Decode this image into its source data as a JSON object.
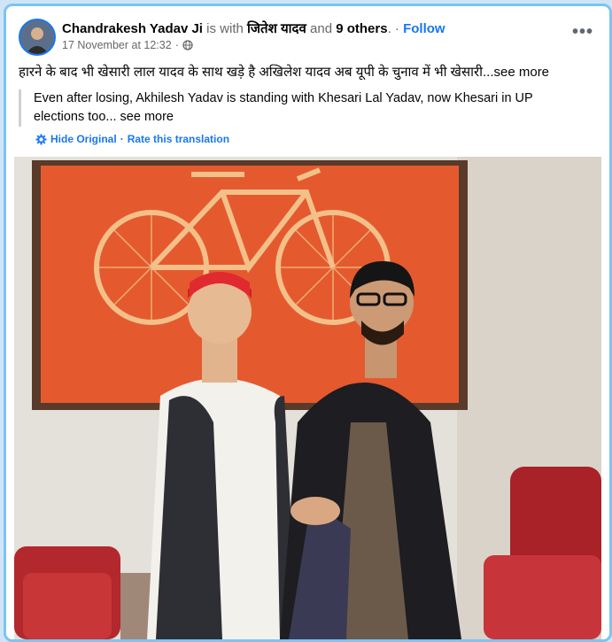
{
  "post": {
    "author": "Chandrakesh Yadav Ji",
    "with_text": "is with",
    "tagged": "जितेश यादव",
    "and_text": "and",
    "others": "9 others",
    "dot": ".",
    "sep": "·",
    "follow": "Follow",
    "date": "17 November at 12:32",
    "date_sep": "·",
    "audience_icon": "globe-icon",
    "more_icon": "•••",
    "caption": "हारने के बाद भी खेसारी लाल यादव के साथ खड़े है अखिलेश यादव अब यूपी के चुनाव में भी खेसारी...",
    "caption_see_more": "see more",
    "translation_line1": "Even after losing, Akhilesh Yadav is standing with Khesari Lal Yadav, now Khesari in UP",
    "translation_line2": "elections too...",
    "translation_see_more": "see more",
    "hide_original": "Hide Original",
    "link_sep": "·",
    "rate_translation": "Rate this translation"
  },
  "colors": {
    "link": "#1877f2",
    "frame": "#7cc4f3",
    "poster_bg": "#e45a2e",
    "bicycle": "#f3c08a"
  }
}
